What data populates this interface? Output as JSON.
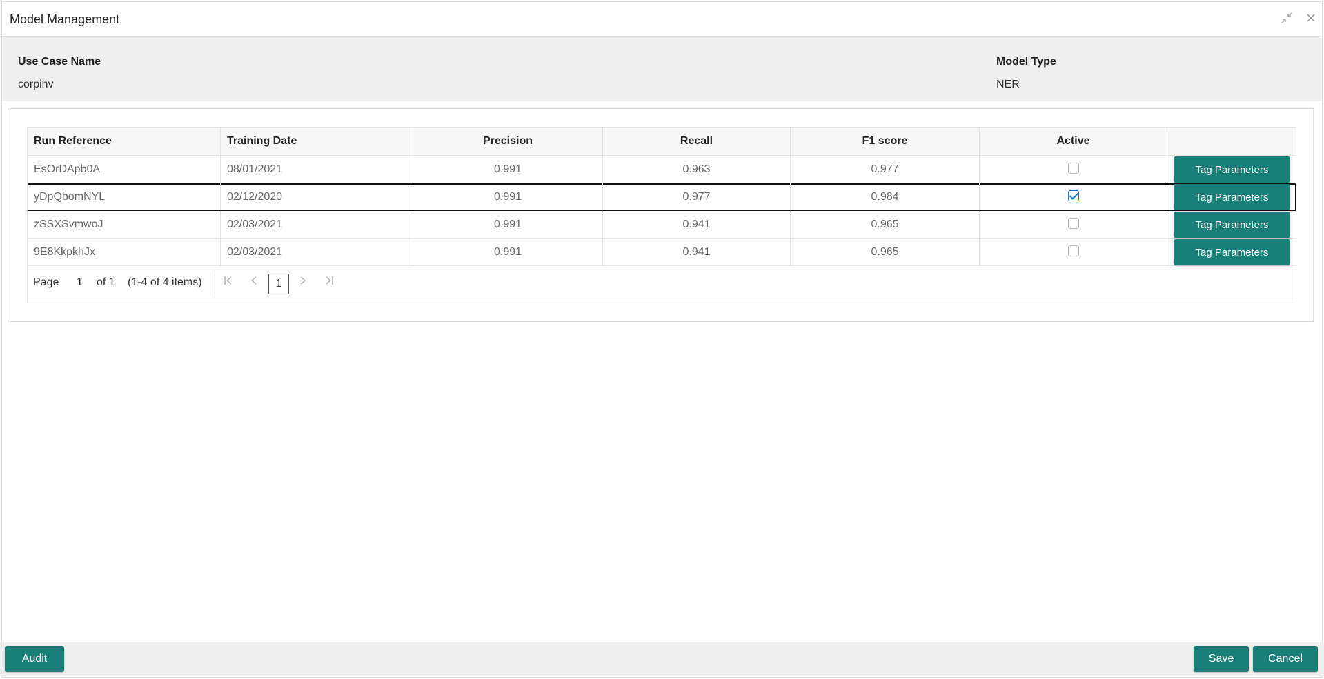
{
  "window": {
    "title": "Model Management"
  },
  "info": {
    "use_case_label": "Use Case Name",
    "use_case_value": "corpinv",
    "model_type_label": "Model Type",
    "model_type_value": "NER"
  },
  "table": {
    "columns": [
      "Run Reference",
      "Training Date",
      "Precision",
      "Recall",
      "F1 score",
      "Active"
    ],
    "rows": [
      {
        "run_reference": "EsOrDApb0A",
        "training_date": "08/01/2021",
        "precision": "0.991",
        "recall": "0.963",
        "f1": "0.977",
        "active": false,
        "action": "Tag Parameters"
      },
      {
        "run_reference": "yDpQbomNYL",
        "training_date": "02/12/2020",
        "precision": "0.991",
        "recall": "0.977",
        "f1": "0.984",
        "active": true,
        "action": "Tag Parameters"
      },
      {
        "run_reference": "zSSXSvmwoJ",
        "training_date": "02/03/2021",
        "precision": "0.991",
        "recall": "0.941",
        "f1": "0.965",
        "active": false,
        "action": "Tag Parameters"
      },
      {
        "run_reference": "9E8KkpkhJx",
        "training_date": "02/03/2021",
        "precision": "0.991",
        "recall": "0.941",
        "f1": "0.965",
        "active": false,
        "action": "Tag Parameters"
      }
    ]
  },
  "pager": {
    "page_label": "Page",
    "page_value": "1",
    "of_label": "of 1",
    "items_label": "(1-4 of 4 items)",
    "current_page": "1"
  },
  "footer": {
    "audit_label": "Audit",
    "save_label": "Save",
    "cancel_label": "Cancel"
  },
  "colors": {
    "accent": "#1a7f78",
    "header_bg": "#efefef",
    "check": "#1a6fc6"
  },
  "icons": {
    "minimize": "collapse-icon",
    "close": "close-icon"
  }
}
